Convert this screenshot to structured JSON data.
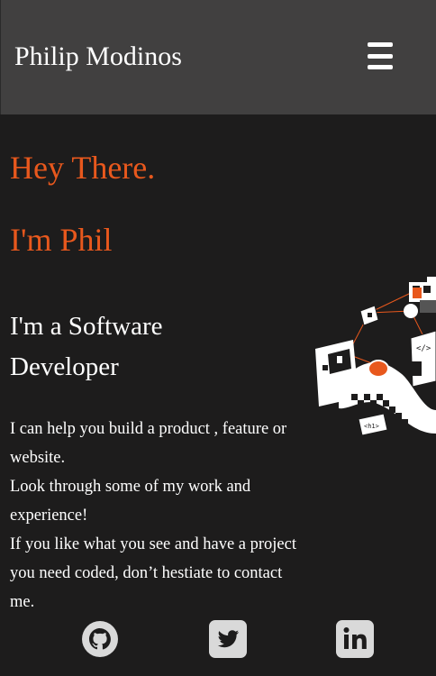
{
  "header": {
    "brand": "Philip Modinos",
    "menu_icon": "hamburger-menu-icon"
  },
  "hero": {
    "greeting": "Hey There.",
    "name_line": "I'm Phil"
  },
  "role": {
    "line1": "I'm a Software",
    "line2": "Developer"
  },
  "intro": {
    "p1": "I can help you build a product , feature or website.",
    "p2": "Look through some of my work and experience!",
    "p3": "If you like what you see and have a project you need coded, don’t hestiate to contact me."
  },
  "socials": [
    {
      "name": "GitHub",
      "icon": "github-icon"
    },
    {
      "name": "Twitter",
      "icon": "twitter-icon"
    },
    {
      "name": "LinkedIn",
      "icon": "linkedin-icon"
    }
  ],
  "colors": {
    "background": "#1d1c1c",
    "header": "#414040",
    "accent": "#e8581d",
    "text": "#ffffff",
    "icon": "#d9d9d9"
  }
}
